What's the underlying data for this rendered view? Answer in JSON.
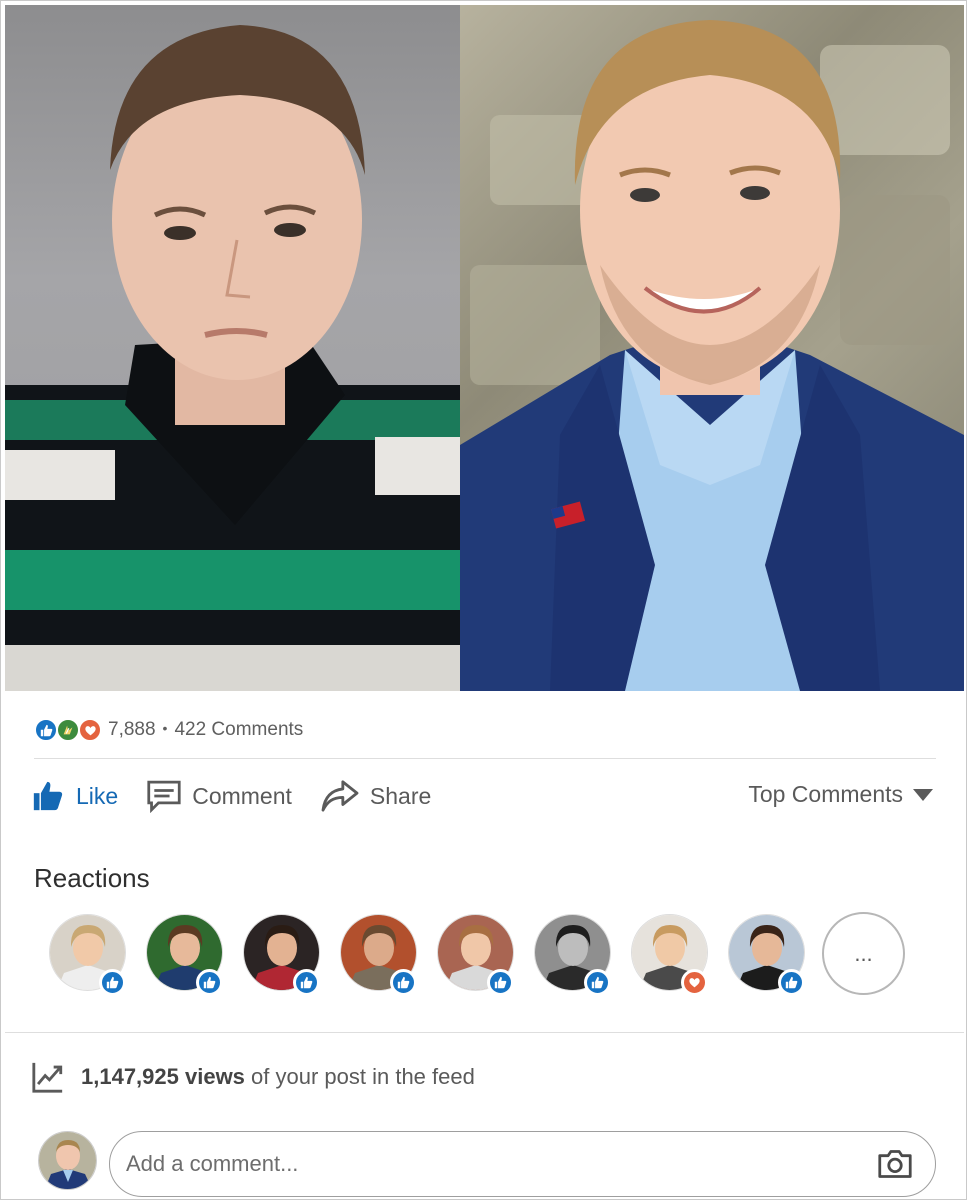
{
  "photos": [
    {
      "name": "left-photo"
    },
    {
      "name": "right-photo"
    }
  ],
  "social": {
    "reaction_icons": [
      "like-icon",
      "celebrate-icon",
      "love-icon"
    ],
    "reaction_count": "7,888",
    "separator": "•",
    "comments_count": "422 Comments"
  },
  "actions": {
    "like": "Like",
    "comment": "Comment",
    "share": "Share",
    "sort": "Top Comments"
  },
  "reactions": {
    "title": "Reactions",
    "people": [
      {
        "reaction": "like",
        "skin": "#f1c9a8",
        "hair": "#c9a873",
        "bg": "#d8d2c8",
        "shirt": "#eeeeee"
      },
      {
        "reaction": "like",
        "skin": "#e7b99a",
        "hair": "#5b3a22",
        "bg": "#2f6a2f",
        "shirt": "#1f3c6e"
      },
      {
        "reaction": "like",
        "skin": "#e3b292",
        "hair": "#2a1c14",
        "bg": "#2b2424",
        "shirt": "#b02733"
      },
      {
        "reaction": "like",
        "skin": "#dcaa8a",
        "hair": "#6a4a30",
        "bg": "#b2502d",
        "shirt": "#7a6e5c"
      },
      {
        "reaction": "like",
        "skin": "#f0c7a8",
        "hair": "#a86f42",
        "bg": "#a96552",
        "shirt": "#d9d9d9"
      },
      {
        "reaction": "like",
        "skin": "#bdbdbd",
        "hair": "#1e1e1e",
        "bg": "#8f8f8f",
        "shirt": "#2a2a2a"
      },
      {
        "reaction": "love",
        "skin": "#f0c9a6",
        "hair": "#c89b60",
        "bg": "#e6e2dc",
        "shirt": "#4a4a4a"
      },
      {
        "reaction": "like",
        "skin": "#e6b898",
        "hair": "#3a2418",
        "bg": "#b9c7d6",
        "shirt": "#1c1c1c"
      }
    ],
    "more": "..."
  },
  "views": {
    "count": "1,147,925 views",
    "suffix": " of your post in the feed"
  },
  "comment": {
    "placeholder": "Add a comment..."
  },
  "colors": {
    "like_blue": "#1569b4",
    "love_orange": "#e4633f",
    "celebrate_green": "#3d8b3d"
  }
}
